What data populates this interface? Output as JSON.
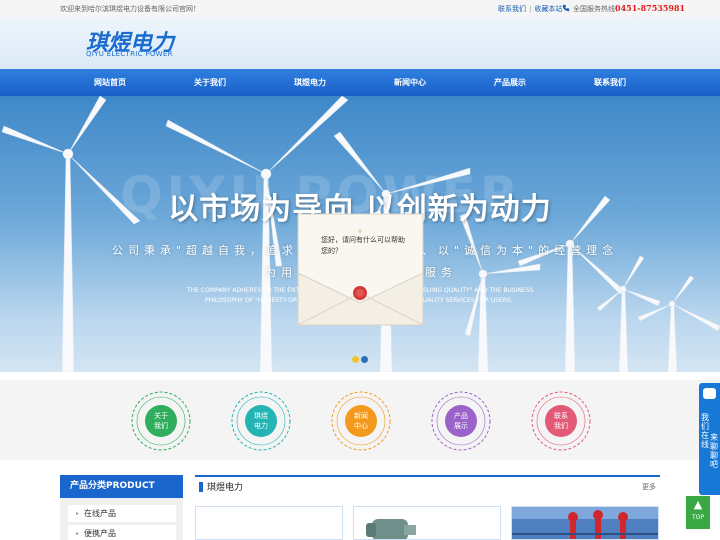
{
  "topbar": {
    "welcome": "欢迎来到哈尔滨琪煜电力设备有限公司官网！",
    "contact_link": "联系我们",
    "bookmark_link": "收藏本站",
    "hotline_label": "全国服务热线：",
    "hotline_number": "0451-87535981"
  },
  "logo": {
    "cn": "琪煜电力",
    "en": "QIYU ELECTRIC POWER"
  },
  "nav": [
    "网站首页",
    "关于我们",
    "琪煜电力",
    "新闻中心",
    "产品展示",
    "联系我们"
  ],
  "banner": {
    "ghost_text": "QIYU POWER",
    "title": "以市场为导向 以创新为动力",
    "sub1_left": "公司秉承\"超越自我，追求优",
    "sub1_right": "、以\"诚信为本\"的经营理念",
    "sub2_left": "为用",
    "sub2_right": "服务",
    "en1_left": "THE COMPANY ADHERES TO THE ENTI",
    "en1_right": "SUING QUALITY\" AND THE BUSINESS",
    "en2_left": "PHILOSOPHY OF \"HONESTY-OR",
    "en2_right": "QUALITY SERVICES FOR USERS.",
    "colors": {
      "dot_active": "#f2c12e",
      "dot_inactive": "#2a6fb8"
    }
  },
  "chat": {
    "message": "您好，请问有什么可以帮助您的？"
  },
  "quick_links": [
    {
      "label_line1": "关于",
      "label_line2": "我们",
      "color": "#2fae5e"
    },
    {
      "label_line1": "琪煜",
      "label_line2": "电力",
      "color": "#23b4b4"
    },
    {
      "label_line1": "新闻",
      "label_line2": "中心",
      "color": "#f39a1e"
    },
    {
      "label_line1": "产品",
      "label_line2": "展示",
      "color": "#9b63c9"
    },
    {
      "label_line1": "联系",
      "label_line2": "我们",
      "color": "#e25a78"
    }
  ],
  "side_tab": {
    "line1": "我们在线",
    "line2": "来聊聊吧"
  },
  "top_button": "TOP",
  "products_sidebar": {
    "heading": "产品分类PRODUCT",
    "items": [
      "在线产品",
      "便携产品"
    ]
  },
  "main_section": {
    "title": "琪煜电力",
    "more": "更多"
  }
}
